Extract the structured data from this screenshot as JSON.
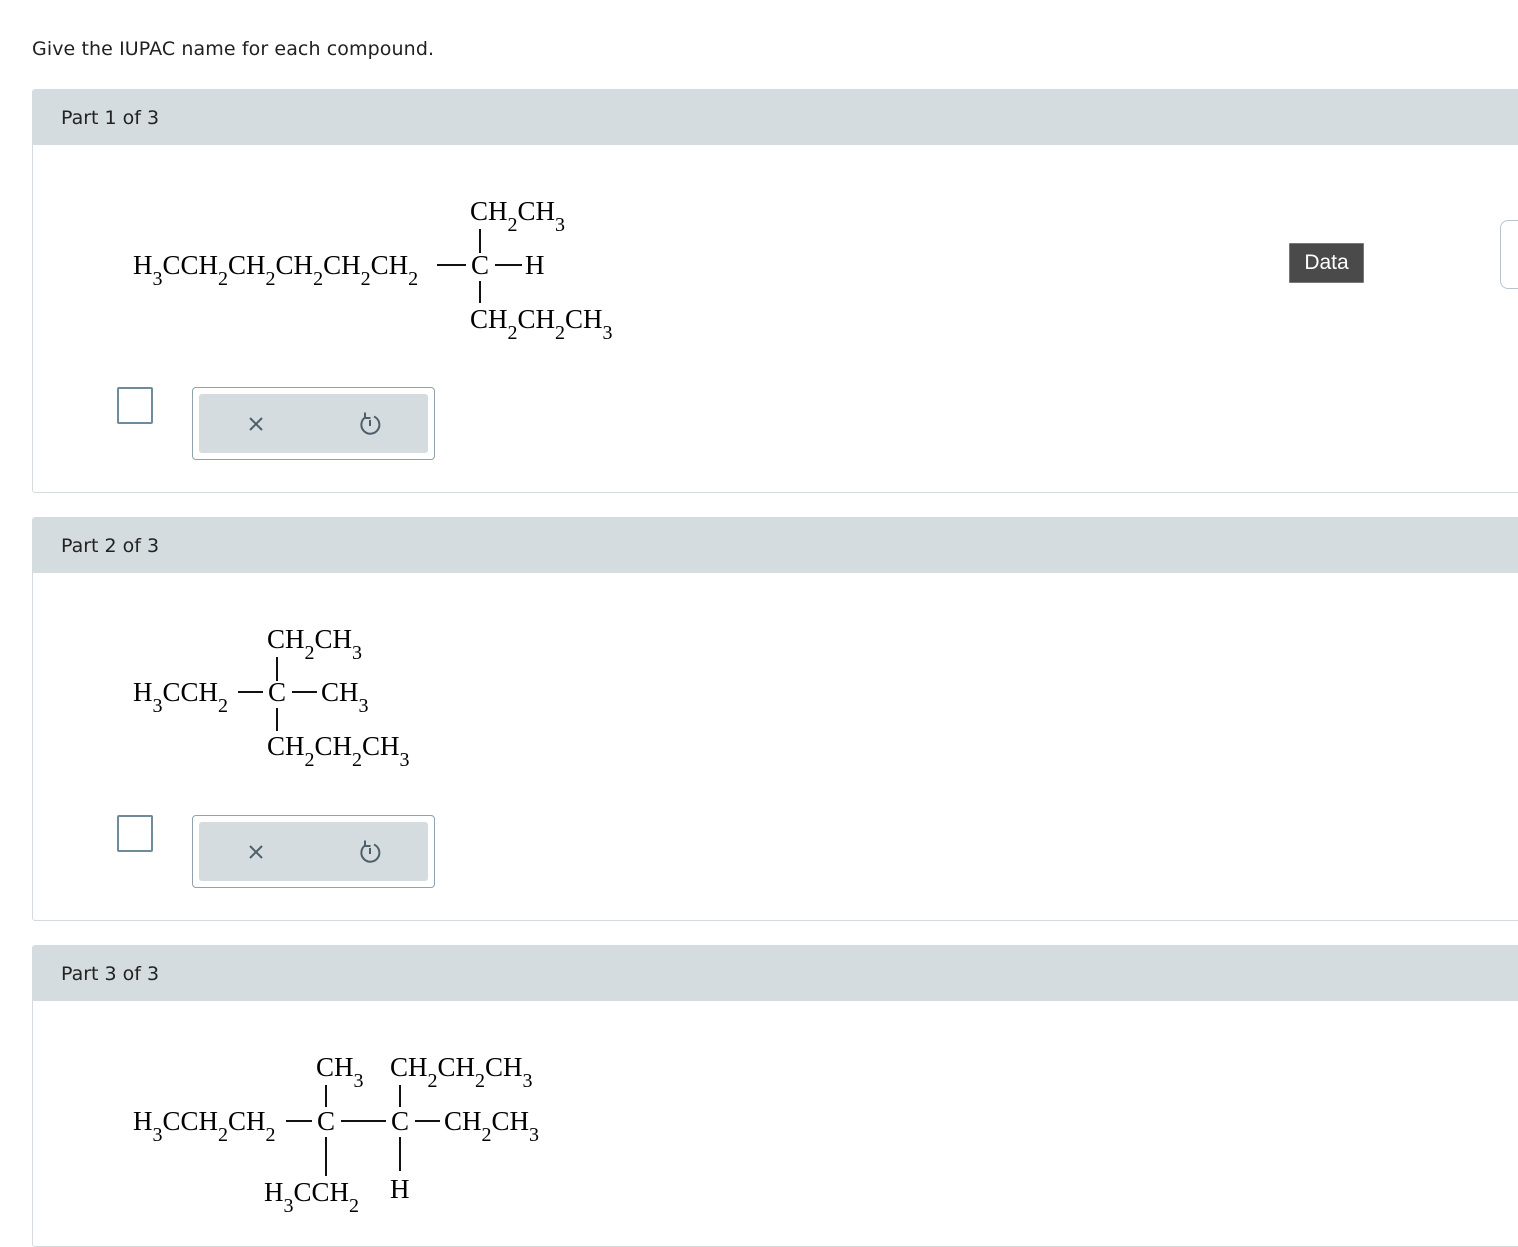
{
  "instruction": "Give the IUPAC name for each compound.",
  "data_button": {
    "label": "Data"
  },
  "parts": [
    {
      "label": "Part 1 of 3",
      "formula": {
        "top": {
          "main": "CH",
          "sub1": "2",
          "main2": "CH",
          "sub2": "3"
        },
        "left": {
          "a": "H",
          "s1": "3",
          "b": "CCH",
          "s2": "2",
          "c": "CH",
          "s3": "2",
          "d": "CH",
          "s4": "2",
          "e": "CH",
          "s5": "2",
          "f": "CH",
          "s6": "2"
        },
        "center": "C",
        "right": "H",
        "bottom": {
          "a": "CH",
          "s1": "2",
          "b": "CH",
          "s2": "2",
          "c": "CH",
          "s3": "3"
        }
      },
      "answer_value": "",
      "tools": {
        "clear": "clear-icon",
        "undo": "undo-icon"
      }
    },
    {
      "label": "Part 2 of 3",
      "formula": {
        "top": {
          "main": "CH",
          "sub1": "2",
          "main2": "CH",
          "sub2": "3"
        },
        "left": {
          "a": "H",
          "s1": "3",
          "b": "CCH",
          "s2": "2"
        },
        "center": "C",
        "right": {
          "a": "CH",
          "s1": "3"
        },
        "bottom": {
          "a": "CH",
          "s1": "2",
          "b": "CH",
          "s2": "2",
          "c": "CH",
          "s3": "3"
        }
      },
      "answer_value": "",
      "tools": {
        "clear": "clear-icon",
        "undo": "undo-icon"
      }
    },
    {
      "label": "Part 3 of 3",
      "formula": {
        "top1": {
          "a": "CH",
          "s1": "3"
        },
        "top2": {
          "a": "CH",
          "s1": "2",
          "b": "CH",
          "s2": "2",
          "c": "CH",
          "s3": "3"
        },
        "left": {
          "a": "H",
          "s1": "3",
          "b": "CCH",
          "s2": "2",
          "c": "CH",
          "s3": "2"
        },
        "center1": "C",
        "center2": "C",
        "right": {
          "a": "CH",
          "s1": "2",
          "b": "CH",
          "s2": "3"
        },
        "bottom1": {
          "a": "H",
          "s1": "3",
          "b": "CCH",
          "s2": "2"
        },
        "bottom2": "H"
      }
    }
  ]
}
